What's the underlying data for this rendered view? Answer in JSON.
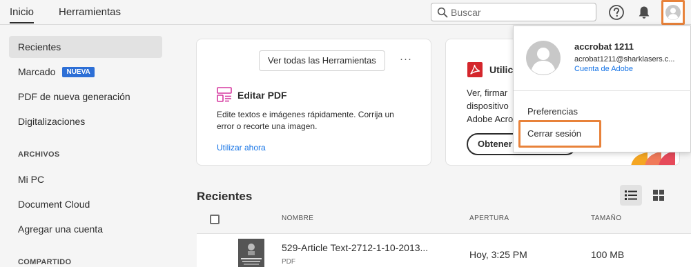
{
  "topbar": {
    "tabs": [
      "Inicio",
      "Herramientas"
    ],
    "search_placeholder": "Buscar",
    "icons": [
      "search-icon",
      "help-icon",
      "bell-icon",
      "avatar-icon"
    ]
  },
  "sidebar": {
    "items": [
      {
        "label": "Recientes"
      },
      {
        "label": "Marcado",
        "badge": "NUEVA"
      },
      {
        "label": "PDF de nueva generación"
      },
      {
        "label": "Digitalizaciones"
      }
    ],
    "archivos_heading": "ARCHIVOS",
    "archivos_items": [
      {
        "label": "Mi PC"
      },
      {
        "label": "Document Cloud"
      },
      {
        "label": "Agregar una cuenta"
      }
    ],
    "compartido_heading": "COMPARTIDO"
  },
  "tools_card": {
    "view_all_label": "Ver todas las Herramientas",
    "more_label": "···",
    "title": "Editar PDF",
    "description": "Edite textos e imágenes rápidamente. Corrija un error o recorte una imagen.",
    "link": "Utilizar ahora"
  },
  "promo_card": {
    "title": "Utilic",
    "desc_lines": [
      "Ver, firmar",
      "dispositivo",
      "Adobe Acro"
    ],
    "button": "Obtener"
  },
  "recents": {
    "title": "Recientes",
    "columns": {
      "name": "NOMBRE",
      "opened": "APERTURA",
      "size": "TAMAÑO"
    },
    "rows": [
      {
        "name": "529-Article Text-2712-1-10-2013...",
        "type": "PDF",
        "opened": "Hoy, 3:25 PM",
        "size": "100 MB"
      }
    ]
  },
  "account_menu": {
    "name": "accrobat 1211",
    "email": "acrobat1211@sharklasers.c...",
    "account_link": "Cuenta de Adobe",
    "preferences": "Preferencias",
    "sign_out": "Cerrar sesión"
  },
  "colors": {
    "accent_blue": "#1473e6",
    "badge_blue": "#2d6fd6",
    "highlight_orange": "#e8823a",
    "pdf_red": "#d4262c",
    "edit_pink": "#d63aa0"
  }
}
